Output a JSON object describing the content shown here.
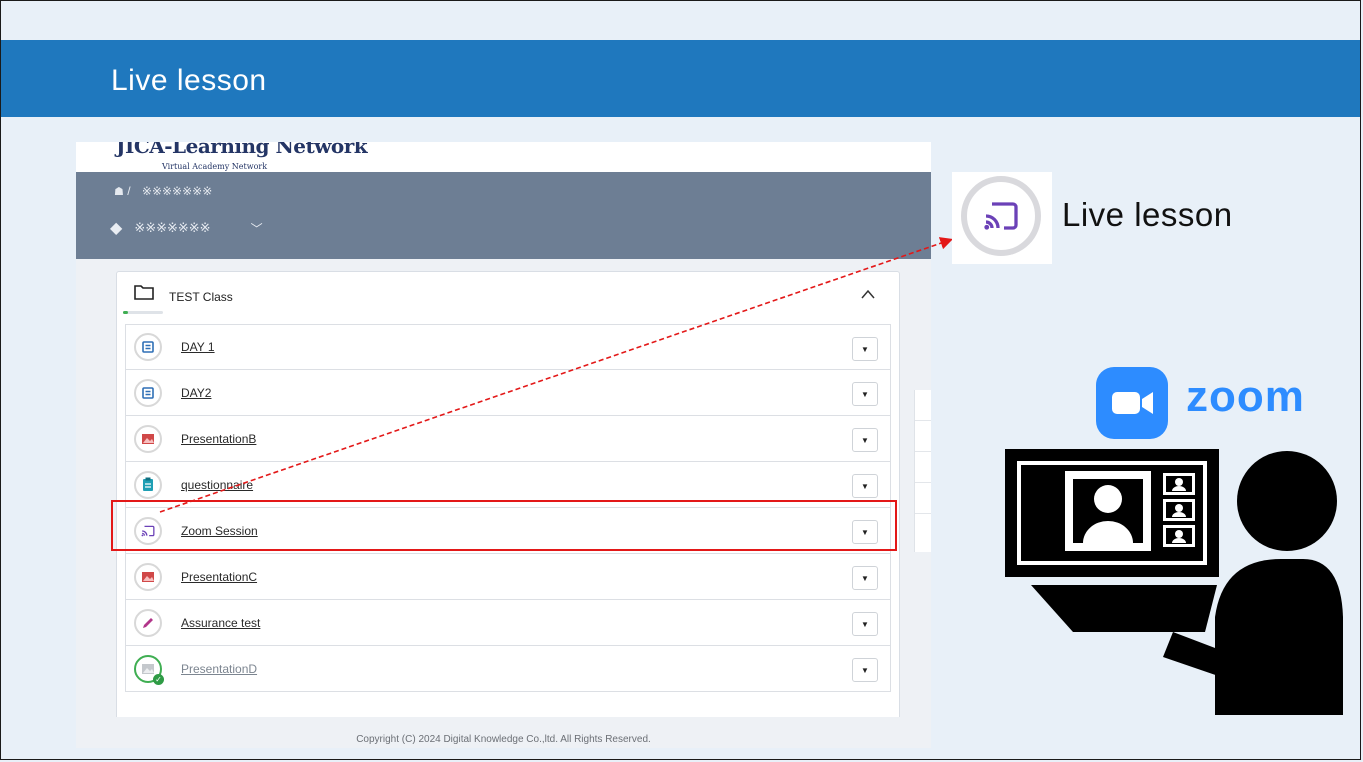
{
  "slide": {
    "title": "Live lesson"
  },
  "lms": {
    "brand_name": "JICA-Learning Network",
    "brand_tagline": "Virtual Academy Network",
    "breadcrumb": "※※※※※※※",
    "course_name": "※※※※※※※",
    "section_title": "TEST Class",
    "section_progress": 0.12,
    "items": [
      {
        "label": "DAY 1",
        "icon": "textbook-icon"
      },
      {
        "label": "DAY2",
        "icon": "textbook-icon"
      },
      {
        "label": "PresentationB",
        "icon": "presentation-icon"
      },
      {
        "label": "questionnaire",
        "icon": "clipboard-icon"
      },
      {
        "label": "Zoom Session",
        "icon": "live-cast-icon"
      },
      {
        "label": "PresentationC",
        "icon": "presentation-icon"
      },
      {
        "label": "Assurance test",
        "icon": "pencil-icon"
      },
      {
        "label": "PresentationD",
        "icon": "presentation-completed-icon"
      }
    ],
    "footer": "Copyright (C) 2024 Digital Knowledge Co.,ltd. All Rights Reserved."
  },
  "callout": {
    "label": "Live lesson",
    "icon": "live-cast-icon"
  },
  "zoom": {
    "brand_text": "zoom",
    "logo_icon": "zoom-camera-icon"
  },
  "colors": {
    "title_bar": "#1f78be",
    "highlight": "#e31818",
    "zoom_blue": "#2d8cff",
    "cast_purple": "#6b41b7"
  }
}
